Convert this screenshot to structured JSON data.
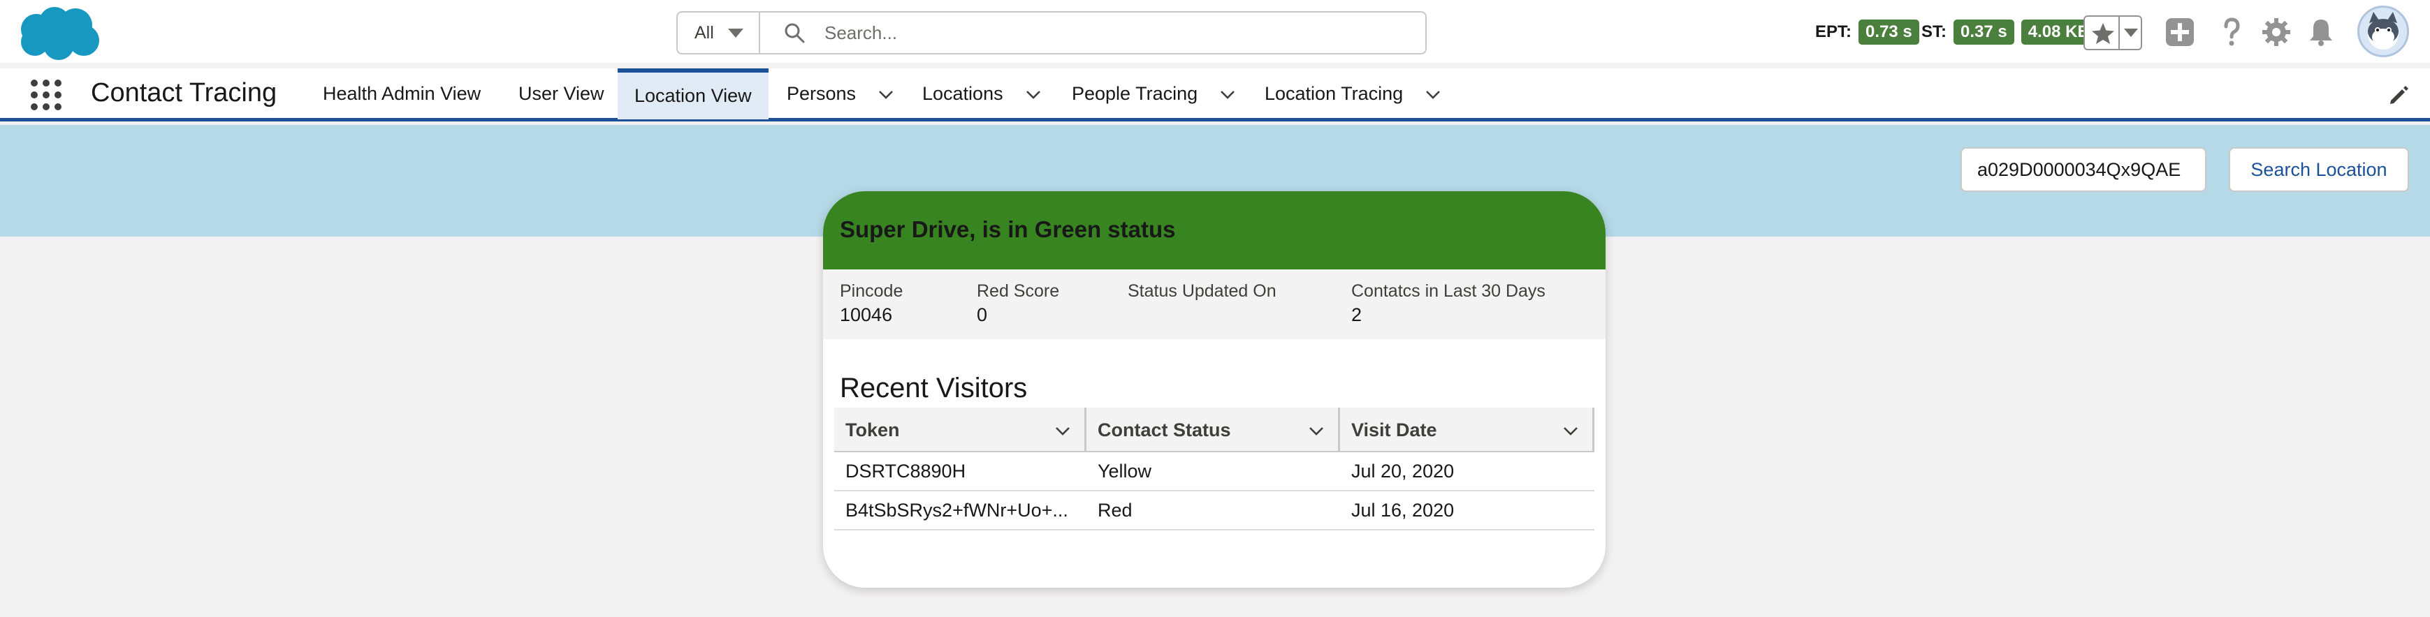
{
  "header": {
    "search_scope": "All",
    "search_placeholder": "Search...",
    "ept_label": "EPT:",
    "ept_value": "0.73 s",
    "st_label": "ST:",
    "st_value": "0.37 s",
    "size_value": "4.08 KB"
  },
  "nav": {
    "app_name": "Contact Tracing",
    "tabs": [
      {
        "label": "Health Admin View",
        "active": false,
        "dropdown": false
      },
      {
        "label": "User View",
        "active": false,
        "dropdown": false
      },
      {
        "label": "Location View",
        "active": true,
        "dropdown": false
      },
      {
        "label": "Persons",
        "active": false,
        "dropdown": true
      },
      {
        "label": "Locations",
        "active": false,
        "dropdown": true
      },
      {
        "label": "People Tracing",
        "active": false,
        "dropdown": true
      },
      {
        "label": "Location Tracing",
        "active": false,
        "dropdown": true
      }
    ]
  },
  "search_panel": {
    "record_id": "a029D0000034Qx9QAE",
    "button_label": "Search Location"
  },
  "card": {
    "title": "Super Drive, is in Green status",
    "status_color": "#378421",
    "stats": [
      {
        "label": "Pincode",
        "value": "10046"
      },
      {
        "label": "Red Score",
        "value": "0"
      },
      {
        "label": "Status Updated On",
        "value": ""
      },
      {
        "label": "Contatcs in Last 30 Days",
        "value": "2"
      }
    ],
    "section_title": "Recent Visitors",
    "columns": [
      "Token",
      "Contact Status",
      "Visit Date"
    ],
    "rows": [
      [
        "DSRTC8890H",
        "Yellow",
        "Jul 20, 2020"
      ],
      [
        "B4tSbSRys2+fWNr+Uo+...",
        "Red",
        "Jul 16, 2020"
      ]
    ]
  },
  "icons": [
    "salesforce-cloud-logo",
    "search-icon",
    "star-icon",
    "plus-icon",
    "help-icon",
    "gear-icon",
    "bell-icon",
    "avatar",
    "app-launcher-icon",
    "chevron-down-icon",
    "pencil-icon"
  ]
}
